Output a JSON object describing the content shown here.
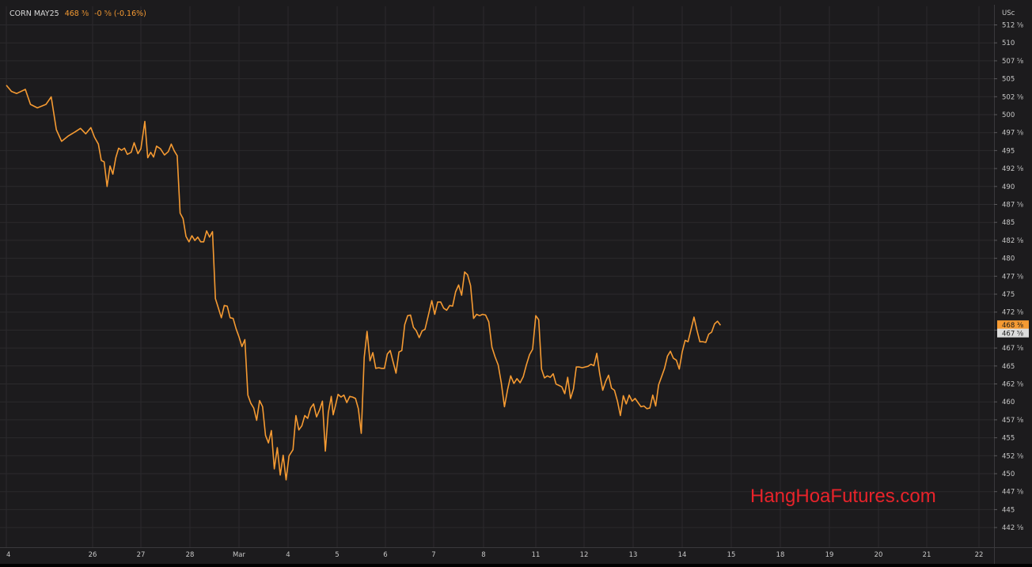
{
  "header": {
    "symbol": "CORN MAY25",
    "last": "468 ⅜",
    "change": "-0 ⅝ (-0.16%)"
  },
  "watermark": "HangHoaFutures.com",
  "colors": {
    "background": "#1c1b1d",
    "grid": "#2b2a2d",
    "line": "#f59a32",
    "tick_text": "#c8c8c8",
    "last_tag": "#f59a32",
    "prev_tag": "#dcdcdc",
    "watermark": "#e8232a"
  },
  "chart_data": {
    "type": "line",
    "title": "CORN MAY25",
    "unit": "USc",
    "ylim": [
      441,
      513
    ],
    "y_ticks": [
      "512 ⅝",
      "510",
      "507 ⅝",
      "505",
      "502 ⅝",
      "500",
      "497 ⅝",
      "495",
      "492 ⅝",
      "490",
      "487 ⅝",
      "485",
      "482 ⅝",
      "480",
      "477 ⅝",
      "475",
      "472 ⅝",
      "470",
      "467 ⅝",
      "465",
      "462 ⅝",
      "460",
      "457 ⅝",
      "455",
      "452 ⅝",
      "450",
      "447 ⅝",
      "445",
      "442 ⅝"
    ],
    "x_ticks": [
      "4",
      "26",
      "27",
      "28",
      "Mar",
      "4",
      "5",
      "6",
      "7",
      "8",
      "11",
      "12",
      "13",
      "14",
      "15",
      "18",
      "19",
      "20",
      "21",
      "22"
    ],
    "last_price_label": "468 ⅜",
    "prev_price_label": "467 ⅝",
    "grid": true,
    "series": [
      {
        "values": [
          [
            0.0,
            503.8
          ],
          [
            0.06,
            502.9
          ],
          [
            0.12,
            502.6
          ],
          [
            0.22,
            503.2
          ],
          [
            0.28,
            501.0
          ],
          [
            0.36,
            500.5
          ],
          [
            0.46,
            501.0
          ],
          [
            0.52,
            502.1
          ],
          [
            0.58,
            497.3
          ],
          [
            0.64,
            495.6
          ],
          [
            0.72,
            496.4
          ],
          [
            0.8,
            497.0
          ],
          [
            0.86,
            497.5
          ],
          [
            0.92,
            496.7
          ],
          [
            0.98,
            497.6
          ],
          [
            1.04,
            496.2
          ],
          [
            1.12,
            495.2
          ],
          [
            1.18,
            492.8
          ],
          [
            1.24,
            492.6
          ],
          [
            1.3,
            489.0
          ],
          [
            1.36,
            492.0
          ],
          [
            1.42,
            490.8
          ],
          [
            1.48,
            493.2
          ],
          [
            1.54,
            494.6
          ],
          [
            1.6,
            494.3
          ],
          [
            1.66,
            494.6
          ],
          [
            1.72,
            493.7
          ],
          [
            1.8,
            494.0
          ],
          [
            1.86,
            495.4
          ],
          [
            1.94,
            493.8
          ],
          [
            2.0,
            494.5
          ],
          [
            2.08,
            498.5
          ],
          [
            2.14,
            493.2
          ],
          [
            2.2,
            494.0
          ],
          [
            2.26,
            493.3
          ],
          [
            2.32,
            494.9
          ],
          [
            2.4,
            494.5
          ],
          [
            2.48,
            493.6
          ],
          [
            2.56,
            494.1
          ],
          [
            2.62,
            495.2
          ],
          [
            2.68,
            494.2
          ],
          [
            2.74,
            493.5
          ],
          [
            2.8,
            485.1
          ],
          [
            2.86,
            484.3
          ],
          [
            2.92,
            481.7
          ],
          [
            2.98,
            480.9
          ],
          [
            3.04,
            481.8
          ],
          [
            3.1,
            481.1
          ],
          [
            3.16,
            481.6
          ],
          [
            3.22,
            480.9
          ],
          [
            3.28,
            480.9
          ],
          [
            3.34,
            482.5
          ],
          [
            3.4,
            481.6
          ],
          [
            3.46,
            482.4
          ],
          [
            3.52,
            472.6
          ],
          [
            3.58,
            471.2
          ],
          [
            3.64,
            469.8
          ],
          [
            3.7,
            471.6
          ],
          [
            3.76,
            471.5
          ],
          [
            3.82,
            469.8
          ],
          [
            3.88,
            469.7
          ],
          [
            3.94,
            468.2
          ],
          [
            4.0,
            467.0
          ],
          [
            4.06,
            465.6
          ],
          [
            4.12,
            466.6
          ],
          [
            4.18,
            458.5
          ],
          [
            4.24,
            457.3
          ],
          [
            4.3,
            456.6
          ],
          [
            4.36,
            454.8
          ],
          [
            4.42,
            457.7
          ],
          [
            4.48,
            456.8
          ],
          [
            4.54,
            452.6
          ],
          [
            4.6,
            451.5
          ],
          [
            4.66,
            453.3
          ],
          [
            4.72,
            447.7
          ],
          [
            4.78,
            450.8
          ],
          [
            4.84,
            446.8
          ],
          [
            4.9,
            449.7
          ],
          [
            4.96,
            446.1
          ],
          [
            5.02,
            449.6
          ],
          [
            5.1,
            450.5
          ],
          [
            5.16,
            455.5
          ],
          [
            5.22,
            453.4
          ],
          [
            5.28,
            454.0
          ],
          [
            5.34,
            455.5
          ],
          [
            5.4,
            455.1
          ],
          [
            5.46,
            456.6
          ],
          [
            5.52,
            457.2
          ],
          [
            5.58,
            455.3
          ],
          [
            5.64,
            456.3
          ],
          [
            5.7,
            457.6
          ],
          [
            5.76,
            450.3
          ],
          [
            5.82,
            455.9
          ],
          [
            5.88,
            458.3
          ],
          [
            5.92,
            455.6
          ],
          [
            5.96,
            456.8
          ],
          [
            6.02,
            458.6
          ],
          [
            6.08,
            458.2
          ],
          [
            6.14,
            458.5
          ],
          [
            6.2,
            457.4
          ],
          [
            6.26,
            458.3
          ],
          [
            6.32,
            458.2
          ],
          [
            6.38,
            458.0
          ],
          [
            6.44,
            456.5
          ],
          [
            6.5,
            452.9
          ],
          [
            6.56,
            464.0
          ],
          [
            6.62,
            467.8
          ],
          [
            6.68,
            463.5
          ],
          [
            6.74,
            464.7
          ],
          [
            6.8,
            462.4
          ],
          [
            6.86,
            462.5
          ],
          [
            6.92,
            462.4
          ],
          [
            6.98,
            462.4
          ],
          [
            7.04,
            464.5
          ],
          [
            7.1,
            465.0
          ],
          [
            7.16,
            463.3
          ],
          [
            7.22,
            461.7
          ],
          [
            7.28,
            464.8
          ],
          [
            7.34,
            465.0
          ],
          [
            7.4,
            468.8
          ],
          [
            7.46,
            470.1
          ],
          [
            7.52,
            470.2
          ],
          [
            7.58,
            468.4
          ],
          [
            7.64,
            467.9
          ],
          [
            7.7,
            466.9
          ],
          [
            7.76,
            467.9
          ],
          [
            7.82,
            468.1
          ],
          [
            7.88,
            469.9
          ],
          [
            7.96,
            472.3
          ],
          [
            8.02,
            470.3
          ],
          [
            8.08,
            472.1
          ],
          [
            8.14,
            472.1
          ],
          [
            8.2,
            471.2
          ],
          [
            8.26,
            470.9
          ],
          [
            8.32,
            471.6
          ],
          [
            8.38,
            471.5
          ],
          [
            8.44,
            473.6
          ],
          [
            8.5,
            474.6
          ],
          [
            8.56,
            473.1
          ],
          [
            8.62,
            476.5
          ],
          [
            8.68,
            476.1
          ],
          [
            8.74,
            474.5
          ],
          [
            8.8,
            469.7
          ],
          [
            8.86,
            470.3
          ],
          [
            8.92,
            470.1
          ],
          [
            8.98,
            470.3
          ],
          [
            9.04,
            470.2
          ],
          [
            9.1,
            469.2
          ],
          [
            9.16,
            465.5
          ],
          [
            9.22,
            464.1
          ],
          [
            9.28,
            462.9
          ],
          [
            9.34,
            460.3
          ],
          [
            9.4,
            456.8
          ],
          [
            9.46,
            459.3
          ],
          [
            9.52,
            461.3
          ],
          [
            9.58,
            460.2
          ],
          [
            9.64,
            460.9
          ],
          [
            9.7,
            460.3
          ],
          [
            9.76,
            461.2
          ],
          [
            9.82,
            462.9
          ],
          [
            9.88,
            464.4
          ],
          [
            9.94,
            465.2
          ],
          [
            10.0,
            470.1
          ],
          [
            10.06,
            469.5
          ],
          [
            10.12,
            462.3
          ],
          [
            10.18,
            461.0
          ],
          [
            10.24,
            461.3
          ],
          [
            10.3,
            461.1
          ],
          [
            10.36,
            461.6
          ],
          [
            10.42,
            460.1
          ],
          [
            10.48,
            459.9
          ],
          [
            10.54,
            459.7
          ],
          [
            10.6,
            458.7
          ],
          [
            10.66,
            461.1
          ],
          [
            10.72,
            458.0
          ],
          [
            10.78,
            459.4
          ],
          [
            10.84,
            462.6
          ],
          [
            10.9,
            462.6
          ],
          [
            10.96,
            462.5
          ],
          [
            11.02,
            462.6
          ],
          [
            11.08,
            462.7
          ],
          [
            11.14,
            463.0
          ],
          [
            11.2,
            462.8
          ],
          [
            11.26,
            464.6
          ],
          [
            11.32,
            461.6
          ],
          [
            11.38,
            459.2
          ],
          [
            11.44,
            460.5
          ],
          [
            11.5,
            461.4
          ],
          [
            11.56,
            459.5
          ],
          [
            11.62,
            459.2
          ],
          [
            11.68,
            457.6
          ],
          [
            11.74,
            455.5
          ],
          [
            11.8,
            458.4
          ],
          [
            11.86,
            457.2
          ],
          [
            11.92,
            458.5
          ],
          [
            11.98,
            457.6
          ],
          [
            12.04,
            458.0
          ],
          [
            12.1,
            457.4
          ],
          [
            12.16,
            456.8
          ],
          [
            12.22,
            456.9
          ],
          [
            12.28,
            456.5
          ],
          [
            12.34,
            456.6
          ],
          [
            12.4,
            458.5
          ],
          [
            12.46,
            456.9
          ],
          [
            12.52,
            460.0
          ],
          [
            12.58,
            461.2
          ],
          [
            12.64,
            462.4
          ],
          [
            12.7,
            464.2
          ],
          [
            12.76,
            464.9
          ],
          [
            12.82,
            463.9
          ],
          [
            12.88,
            463.6
          ],
          [
            12.94,
            462.3
          ],
          [
            13.0,
            464.8
          ],
          [
            13.06,
            466.5
          ],
          [
            13.12,
            466.3
          ],
          [
            13.18,
            468.1
          ],
          [
            13.24,
            469.9
          ],
          [
            13.3,
            468.0
          ],
          [
            13.36,
            466.3
          ],
          [
            13.42,
            466.3
          ],
          [
            13.48,
            466.2
          ],
          [
            13.54,
            467.4
          ],
          [
            13.6,
            467.7
          ],
          [
            13.66,
            468.9
          ],
          [
            13.72,
            469.3
          ],
          [
            13.78,
            468.7
          ]
        ]
      }
    ]
  }
}
